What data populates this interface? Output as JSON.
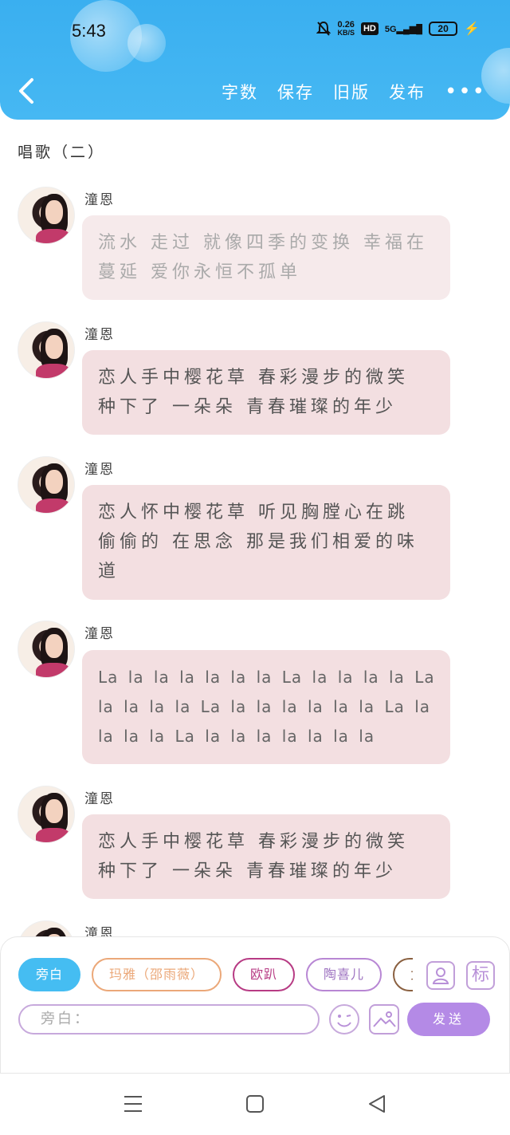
{
  "status_bar": {
    "time": "5:43",
    "net_speed": "0.26",
    "net_unit": "KB/S",
    "hd": "HD",
    "network": "5G",
    "battery": "20"
  },
  "toolbar": {
    "word_count": "字数",
    "save": "保存",
    "old_version": "旧版",
    "publish": "发布"
  },
  "title": "唱歌（二）",
  "messages": [
    {
      "name": "潼恩",
      "text": "流水 走过  就像四季的变换  幸福在蔓延  爱你永恒不孤单",
      "faded": true
    },
    {
      "name": "潼恩",
      "text": "恋人手中樱花草  春彩漫步的微笑 种下了 一朵朵  青春璀璨的年少"
    },
    {
      "name": "潼恩",
      "text": "恋人怀中樱花草  听见胸膛心在跳 偷偷的 在思念  那是我们相爱的味道"
    },
    {
      "name": "潼恩",
      "text": "La la la la la la la  La la la la la  La la la la la  La la la la la la la  La la la la  la  La la la la la la la la"
    },
    {
      "name": "潼恩",
      "text": "恋人手中樱花草  春彩漫步的微笑 种下了 一朵朵  青春璀璨的年少"
    }
  ],
  "partial_name": "潼恩",
  "composer": {
    "roles": [
      "旁白",
      "玛雅（邵雨薇）",
      "欧趴",
      "陶喜儿",
      "女"
    ],
    "add_role_icon": "person-card-icon",
    "tag_label": "标",
    "input_placeholder": "旁白：",
    "send_label": "发送"
  },
  "colors": {
    "header": "#3aaff0",
    "bubble": "#f3dfe1",
    "send": "#b48ae6",
    "active_chip": "#45bdf2"
  }
}
